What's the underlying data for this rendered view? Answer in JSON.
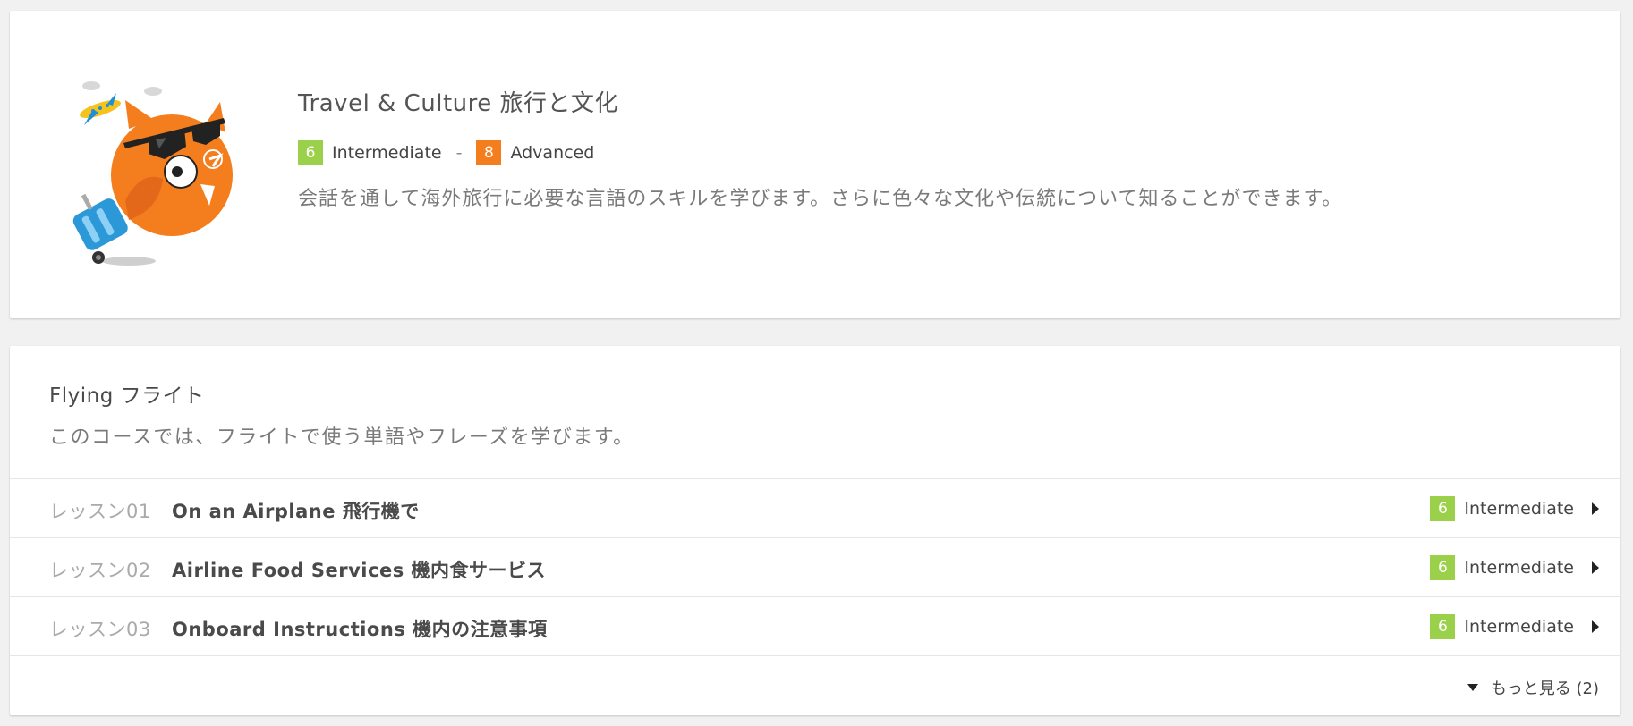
{
  "course_group": {
    "title": "Travel & Culture 旅行と文化",
    "level_from": {
      "number": "6",
      "label": "Intermediate",
      "color": "#9bd14a"
    },
    "level_separator": "-",
    "level_to": {
      "number": "8",
      "label": "Advanced",
      "color": "#f47d1d"
    },
    "description": "会話を通して海外旅行に必要な言語のスキルを学びます。さらに色々な文化や伝統について知ることができます。",
    "mascot_icon": "owl-traveler-mascot"
  },
  "course": {
    "title": "Flying フライト",
    "description": "このコースでは、フライトで使う単語やフレーズを学びます。",
    "lessons": [
      {
        "number": "レッスン01",
        "title": "On an Airplane 飛行機で",
        "level_number": "6",
        "level_label": "Intermediate"
      },
      {
        "number": "レッスン02",
        "title": "Airline Food Services 機内食サービス",
        "level_number": "6",
        "level_label": "Intermediate"
      },
      {
        "number": "レッスン03",
        "title": "Onboard Instructions 機内の注意事項",
        "level_number": "6",
        "level_label": "Intermediate"
      }
    ],
    "more_label": "もっと見る (2)"
  }
}
